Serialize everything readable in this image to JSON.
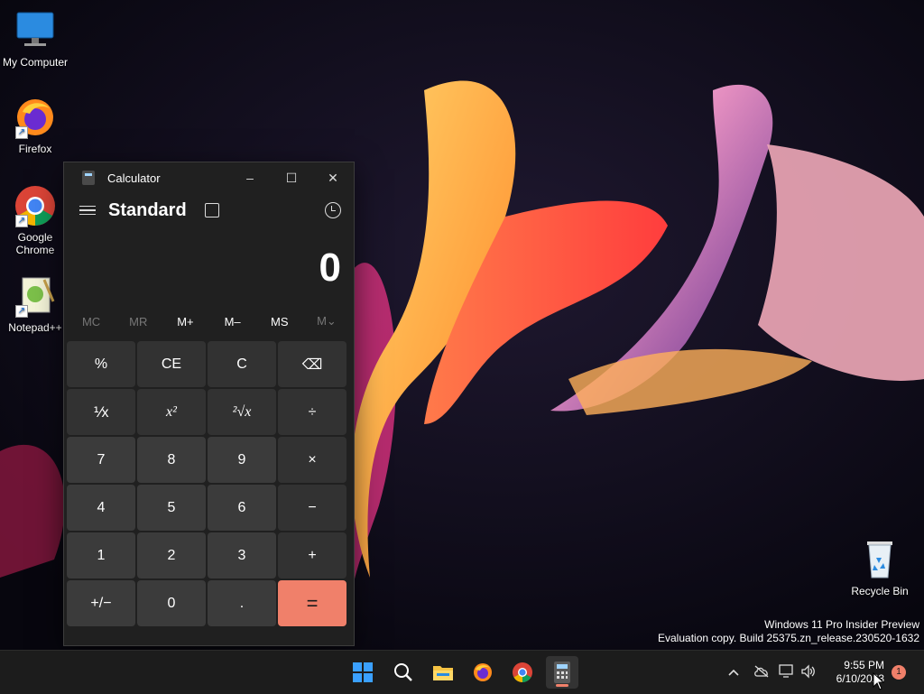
{
  "desktop": {
    "icons": [
      {
        "label": "My Computer",
        "icon": "monitor-icon"
      },
      {
        "label": "Firefox",
        "icon": "firefox-icon"
      },
      {
        "label": "Google Chrome",
        "icon": "chrome-icon"
      },
      {
        "label": "Notepad++",
        "icon": "notepadpp-icon"
      },
      {
        "label": "Recycle Bin",
        "icon": "recycle-bin-icon"
      }
    ],
    "watermark": {
      "line1": "Windows 11 Pro Insider Preview",
      "line2": "Evaluation copy. Build 25375.zn_release.230520-1632"
    }
  },
  "calculator": {
    "window_title": "Calculator",
    "window_buttons": [
      "–",
      "☐",
      "✕"
    ],
    "mode": "Standard",
    "display_value": "0",
    "memory_buttons": [
      {
        "label": "MC",
        "enabled": false
      },
      {
        "label": "MR",
        "enabled": false
      },
      {
        "label": "M+",
        "enabled": true
      },
      {
        "label": "M–",
        "enabled": true
      },
      {
        "label": "MS",
        "enabled": true
      },
      {
        "label": "M⌄",
        "enabled": false
      }
    ],
    "keys": [
      "%",
      "CE",
      "C",
      "⌫",
      "⅟x",
      "x²",
      "²√x",
      "÷",
      "7",
      "8",
      "9",
      "×",
      "4",
      "5",
      "6",
      "−",
      "1",
      "2",
      "3",
      "+",
      "+/−",
      "0",
      ".",
      "="
    ],
    "accent_color": "#f0806a"
  },
  "taskbar": {
    "apps": [
      "start-icon",
      "search-icon",
      "file-explorer-icon",
      "firefox-icon",
      "chrome-icon",
      "calculator-icon"
    ],
    "active_app": "calculator-icon",
    "tray": [
      "chevron-up-icon",
      "cloud-offline-icon",
      "network-icon",
      "volume-icon"
    ],
    "time": "9:55 PM",
    "date": "6/10/2023",
    "notification_count": "1"
  }
}
